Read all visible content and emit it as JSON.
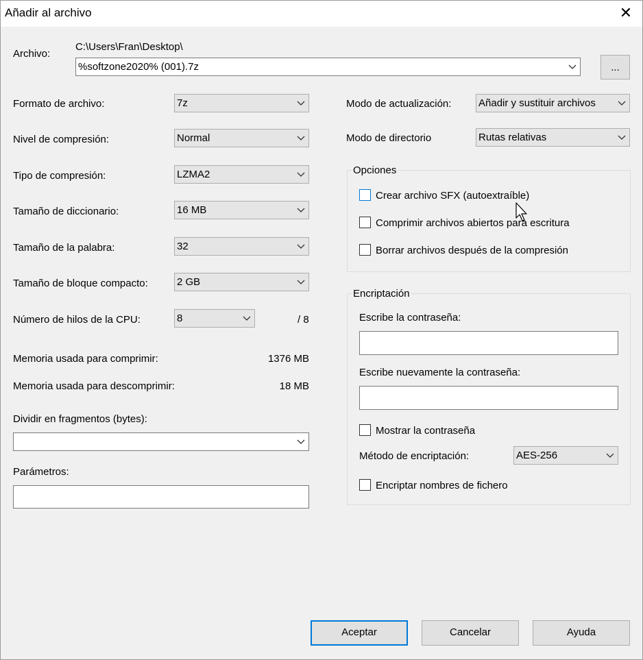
{
  "window": {
    "title": "Añadir al archivo"
  },
  "archive": {
    "label": "Archivo:",
    "path": "C:\\Users\\Fran\\Desktop\\",
    "filename": "%softzone2020% (001).7z",
    "browse_label": "..."
  },
  "left": {
    "format": {
      "label": "Formato de archivo:",
      "value": "7z"
    },
    "level": {
      "label": "Nivel de compresión:",
      "value": "Normal"
    },
    "method": {
      "label": "Tipo de compresión:",
      "value": "LZMA2"
    },
    "dictionary": {
      "label": "Tamaño de diccionario:",
      "value": "16 MB"
    },
    "word": {
      "label": "Tamaño de la palabra:",
      "value": "32"
    },
    "solid": {
      "label": "Tamaño de bloque compacto:",
      "value": "2 GB"
    },
    "threads": {
      "label": "Número de hilos de la CPU:",
      "value": "8",
      "max": "/ 8"
    },
    "mem_compress": {
      "label": "Memoria usada para comprimir:",
      "value": "1376 MB"
    },
    "mem_decompress": {
      "label": "Memoria usada para descomprimir:",
      "value": "18 MB"
    },
    "split": {
      "label": "Dividir en fragmentos (bytes):",
      "value": ""
    },
    "params": {
      "label": "Parámetros:",
      "value": ""
    }
  },
  "right": {
    "update_mode": {
      "label": "Modo de actualización:",
      "value": "Añadir y sustituir archivos"
    },
    "path_mode": {
      "label": "Modo de directorio",
      "value": "Rutas relativas"
    },
    "options": {
      "title": "Opciones",
      "sfx": "Crear archivo SFX (autoextraíble)",
      "shared": "Comprimir archivos abiertos para escritura",
      "delete": "Borrar archivos después de la compresión"
    },
    "encryption": {
      "title": "Encriptación",
      "password_label": "Escribe la contraseña:",
      "password2_label": "Escribe nuevamente la contraseña:",
      "show_password": "Mostrar la contraseña",
      "method_label": "Método de encriptación:",
      "method_value": "AES-256",
      "encrypt_names": "Encriptar nombres de fichero"
    }
  },
  "buttons": {
    "ok": "Aceptar",
    "cancel": "Cancelar",
    "help": "Ayuda"
  },
  "colors": {
    "accent": "#0078d7",
    "background": "#f0f0f0"
  }
}
